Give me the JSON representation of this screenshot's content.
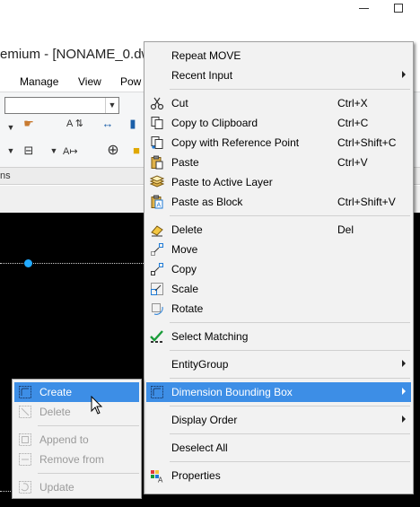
{
  "window": {
    "title": "emium - [NONAME_0.dw"
  },
  "menubar": {
    "items": [
      "Manage",
      "View",
      "Pow"
    ]
  },
  "ribbon": {
    "panel_label": "ns"
  },
  "context_menu": {
    "items": [
      {
        "label": "Repeat MOVE",
        "shortcut": "",
        "icon": "none"
      },
      {
        "label": "Recent Input",
        "shortcut": "",
        "icon": "none",
        "submenu": true
      },
      {
        "label": "Cut",
        "shortcut": "Ctrl+X",
        "icon": "scissors-icon"
      },
      {
        "label": "Copy to Clipboard",
        "shortcut": "Ctrl+C",
        "icon": "copy-icon"
      },
      {
        "label": "Copy with Reference Point",
        "shortcut": "Ctrl+Shift+C",
        "icon": "copy-base-point-icon"
      },
      {
        "label": "Paste",
        "shortcut": "Ctrl+V",
        "icon": "paste-icon"
      },
      {
        "label": "Paste to Active Layer",
        "shortcut": "",
        "icon": "paste-layer-icon"
      },
      {
        "label": "Paste as Block",
        "shortcut": "Ctrl+Shift+V",
        "icon": "paste-block-icon"
      },
      {
        "label": "Delete",
        "shortcut": "Del",
        "icon": "eraser-icon"
      },
      {
        "label": "Move",
        "shortcut": "",
        "icon": "move-icon"
      },
      {
        "label": "Copy",
        "shortcut": "",
        "icon": "copy-entity-icon"
      },
      {
        "label": "Scale",
        "shortcut": "",
        "icon": "scale-icon"
      },
      {
        "label": "Rotate",
        "shortcut": "",
        "icon": "rotate-icon"
      },
      {
        "label": "Select Matching",
        "shortcut": "",
        "icon": "select-matching-icon"
      },
      {
        "label": "EntityGroup",
        "shortcut": "",
        "icon": "none",
        "submenu": true
      },
      {
        "label": "Dimension Bounding Box",
        "shortcut": "",
        "icon": "dimension-bounding-box-icon",
        "submenu": true,
        "highlighted": true
      },
      {
        "label": "Display Order",
        "shortcut": "",
        "icon": "none",
        "submenu": true
      },
      {
        "label": "Deselect All",
        "shortcut": "",
        "icon": "none"
      },
      {
        "label": "Properties",
        "shortcut": "",
        "icon": "properties-icon"
      }
    ]
  },
  "submenu": {
    "items": [
      {
        "label": "Create",
        "icon": "create-bounding-box-icon",
        "highlighted": true
      },
      {
        "label": "Delete",
        "icon": "delete-bounding-box-icon",
        "disabled": true
      },
      {
        "label": "Append to",
        "icon": "append-bounding-box-icon",
        "disabled": true
      },
      {
        "label": "Remove from",
        "icon": "remove-bounding-box-icon",
        "disabled": true
      },
      {
        "label": "Update",
        "icon": "update-bounding-box-icon",
        "disabled": true
      }
    ]
  },
  "colors": {
    "highlight": "#3d8ee6",
    "canvas": "#000000",
    "grip": "#22aaff"
  }
}
